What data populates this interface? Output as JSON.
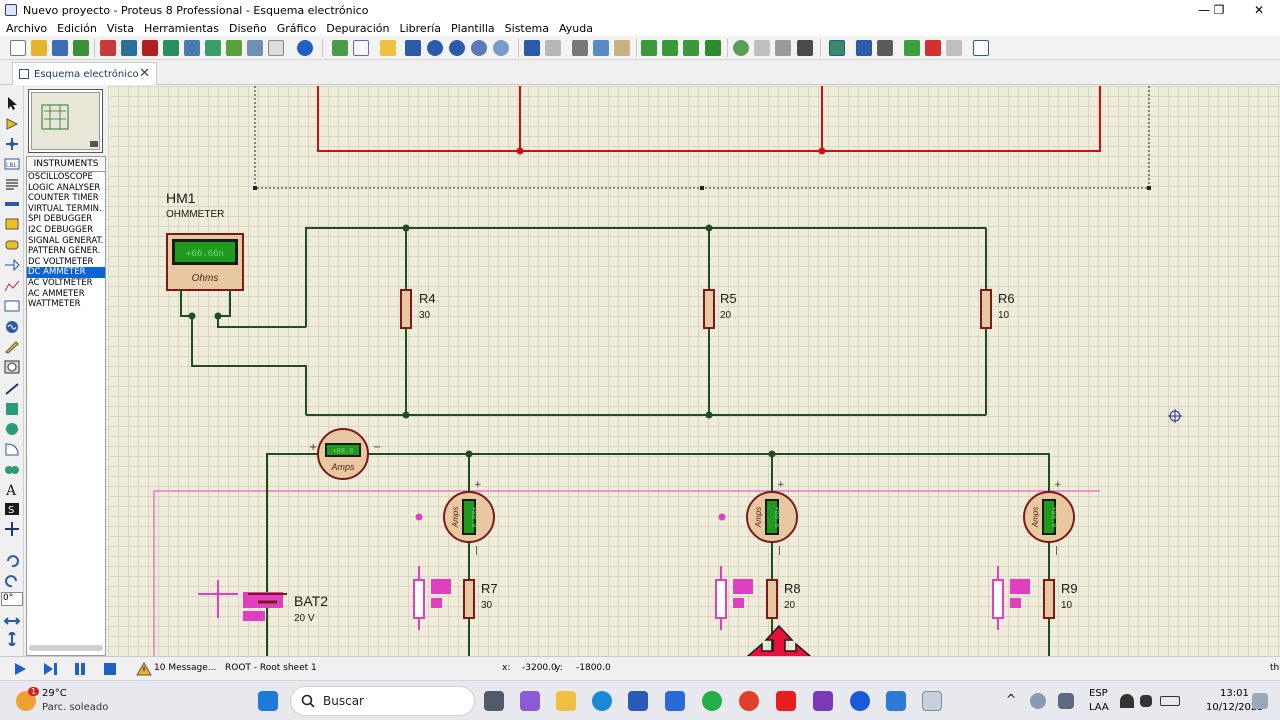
{
  "window": {
    "title": "Nuevo proyecto - Proteus 8 Professional - Esquema electrónico",
    "min": "—",
    "max": "❐",
    "close": "✕"
  },
  "menu": [
    "Archivo",
    "Edición",
    "Vista",
    "Herramientas",
    "Diseño",
    "Gráfico",
    "Depuración",
    "Librería",
    "Plantilla",
    "Sistema",
    "Ayuda"
  ],
  "tab": {
    "label": "Esquema electrónico",
    "close": "✕"
  },
  "instruments": {
    "header": "INSTRUMENTS",
    "items": [
      "OSCILLOSCOPE",
      "LOGIC ANALYSER",
      "COUNTER TIMER",
      "VIRTUAL TERMIN.",
      "SPI DEBUGGER",
      "I2C DEBUGGER",
      "SIGNAL GENERAT.",
      "PATTERN GENER.",
      "DC VOLTMETER",
      "DC AMMETER",
      "AC VOLTMETER",
      "AC AMMETER",
      "WATTMETER"
    ],
    "selected": "DC AMMETER"
  },
  "rotation_value": "0°",
  "schematic": {
    "ohmmeter": {
      "ref": "HM1",
      "type": "OHMMETER",
      "display": "+66.66n",
      "unit": "Ohms"
    },
    "resistors": [
      {
        "ref": "R4",
        "value": "30"
      },
      {
        "ref": "R5",
        "value": "20"
      },
      {
        "ref": "R6",
        "value": "10"
      },
      {
        "ref": "R7",
        "value": "30"
      },
      {
        "ref": "R8",
        "value": "20"
      },
      {
        "ref": "R9",
        "value": "10"
      }
    ],
    "main_ammeter": {
      "display": "+88.8",
      "unit": "Amps",
      "plus": "+",
      "minus": "−"
    },
    "branch_ammeters": [
      {
        "display": "+88.8",
        "unit": "Amps",
        "plus": "+",
        "minus": "|"
      },
      {
        "display": "+88.8",
        "unit": "Amps",
        "plus": "+",
        "minus": "|"
      },
      {
        "display": "+88.8",
        "unit": "Amps",
        "plus": "+",
        "minus": "|"
      }
    ],
    "battery": {
      "ref": "BAT2",
      "value": "20 V"
    },
    "colors": {
      "wire": "#1f4d1f",
      "red_wire": "#d01010",
      "component": "#7a1a1a",
      "pink": "#e040c0",
      "lcd": "#1e7a1e"
    }
  },
  "status": {
    "messages": "10 Message...",
    "sheet": "ROOT - Root sheet 1",
    "x_label": "x:",
    "x": "-3200.0",
    "y_label": "y:",
    "y": "-1800.0",
    "right": "th"
  },
  "taskbar": {
    "weather_temp": "29°C",
    "weather_desc": "Parc. soleado",
    "weather_badge": "1",
    "search": "Buscar",
    "lang": "ESP",
    "lang2": "LAA",
    "time": "13:01",
    "date": "10/12/2025"
  }
}
